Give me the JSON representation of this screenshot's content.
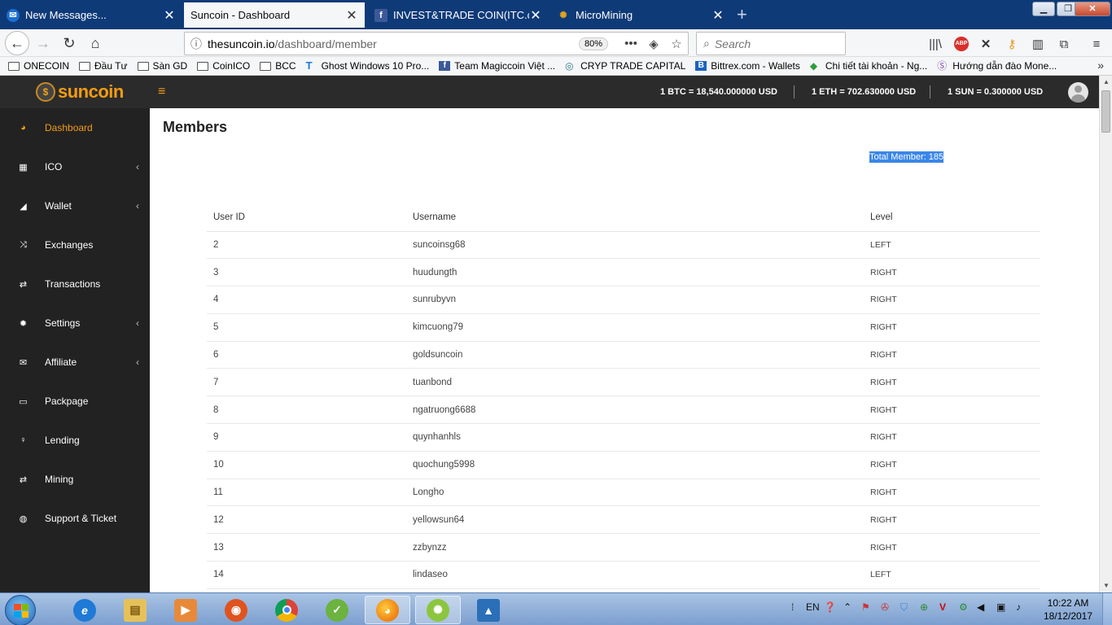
{
  "browser": {
    "tabs": [
      {
        "title": "New Messages...",
        "icon": "messenger-icon",
        "active": false
      },
      {
        "title": "Suncoin - Dashboard",
        "icon": "suncoin-icon",
        "active": true
      },
      {
        "title": "INVEST&TRADE COIN(ITC.com",
        "icon": "facebook-icon",
        "active": false
      },
      {
        "title": "MicroMining",
        "icon": "micromining-icon",
        "active": false
      }
    ],
    "url_host": "thesuncoin.io",
    "url_path": "/dashboard/member",
    "zoom": "80%",
    "search_placeholder": "Search",
    "bookmarks": [
      {
        "label": "ONECOIN",
        "icon": "folder-icon"
      },
      {
        "label": "Đầu Tư",
        "icon": "folder-icon"
      },
      {
        "label": "Sàn GD",
        "icon": "folder-icon"
      },
      {
        "label": "CoinICO",
        "icon": "folder-icon"
      },
      {
        "label": "BCC",
        "icon": "folder-icon"
      },
      {
        "label": "Ghost Windows 10 Pro...",
        "icon": "ghost-icon"
      },
      {
        "label": "Team Magiccoin Việt ...",
        "icon": "facebook-icon"
      },
      {
        "label": "CRYP TRADE CAPITAL",
        "icon": "cryp-icon"
      },
      {
        "label": "Bittrex.com - Wallets",
        "icon": "bittrex-icon"
      },
      {
        "label": "Chi tiết tài khoản - Ng...",
        "icon": "bank-icon"
      },
      {
        "label": "Hướng dẫn đào Mone...",
        "icon": "monero-icon"
      }
    ]
  },
  "header": {
    "brand": "suncoin",
    "rates": [
      {
        "text": "1 BTC = 18,540.000000 USD"
      },
      {
        "text": "1 ETH = 702.630000 USD"
      },
      {
        "text": "1 SUN = 0.300000 USD"
      }
    ]
  },
  "sidebar": {
    "items": [
      {
        "label": "Dashboard",
        "icon": "dashboard-icon",
        "glyph": "◕",
        "has_caret": false,
        "active": true
      },
      {
        "label": "ICO",
        "icon": "grid-icon",
        "glyph": "▦",
        "has_caret": true,
        "active": false
      },
      {
        "label": "Wallet",
        "icon": "wallet-icon",
        "glyph": "◢",
        "has_caret": true,
        "active": false
      },
      {
        "label": "Exchanges",
        "icon": "shuffle-icon",
        "glyph": "⤨",
        "has_caret": false,
        "active": false
      },
      {
        "label": "Transactions",
        "icon": "exchange-icon",
        "glyph": "⇄",
        "has_caret": false,
        "active": false
      },
      {
        "label": "Settings",
        "icon": "gear-icon",
        "glyph": "✹",
        "has_caret": true,
        "active": false
      },
      {
        "label": "Affiliate",
        "icon": "envelope-icon",
        "glyph": "✉",
        "has_caret": true,
        "active": false
      },
      {
        "label": "Packpage",
        "icon": "folder-icon",
        "glyph": "▭",
        "has_caret": false,
        "active": false
      },
      {
        "label": "Lending",
        "icon": "pin-icon",
        "glyph": "♀",
        "has_caret": false,
        "active": false
      },
      {
        "label": "Mining",
        "icon": "exchange-icon",
        "glyph": "⇄",
        "has_caret": false,
        "active": false
      },
      {
        "label": "Support & Ticket",
        "icon": "support-icon",
        "glyph": "◍",
        "has_caret": false,
        "active": false
      }
    ]
  },
  "main": {
    "title": "Members",
    "total_member": "Total Member: 185",
    "columns": [
      "User ID",
      "Username",
      "Level"
    ],
    "rows": [
      [
        "2",
        "suncoinsg68",
        "LEFT"
      ],
      [
        "3",
        "huudungth",
        "RIGHT"
      ],
      [
        "4",
        "sunrubyvn",
        "RIGHT"
      ],
      [
        "5",
        "kimcuong79",
        "RIGHT"
      ],
      [
        "6",
        "goldsuncoin",
        "RIGHT"
      ],
      [
        "7",
        "tuanbond",
        "RIGHT"
      ],
      [
        "8",
        "ngatruong6688",
        "RIGHT"
      ],
      [
        "9",
        "quynhanhls",
        "RIGHT"
      ],
      [
        "10",
        "quochung5998",
        "RIGHT"
      ],
      [
        "11",
        "Longho",
        "RIGHT"
      ],
      [
        "12",
        "yellowsun64",
        "RIGHT"
      ],
      [
        "13",
        "zzbynzz",
        "RIGHT"
      ],
      [
        "14",
        "lindaseo",
        "LEFT"
      ]
    ]
  },
  "taskbar": {
    "language": "EN",
    "time": "10:22 AM",
    "date": "18/12/2017"
  },
  "colors": {
    "accent": "#f39c12",
    "header_bg": "#2b2b2b",
    "sidebar_bg": "#222222",
    "tabbar_bg": "#0f3a78"
  }
}
